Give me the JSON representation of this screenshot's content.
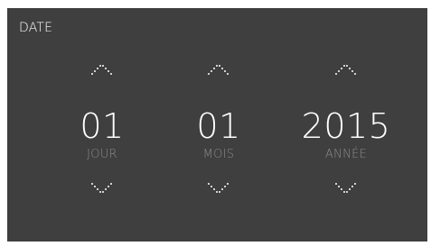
{
  "window": {
    "title": "DATE"
  },
  "columns": [
    {
      "value": "01",
      "label": "JOUR"
    },
    {
      "value": "01",
      "label": "MOIS"
    },
    {
      "value": "2015",
      "label": "ANNÉE"
    }
  ],
  "icons": {
    "up": "chevron-up-icon",
    "down": "chevron-down-icon"
  },
  "colors": {
    "background": "#3f3f3f",
    "text": "#ffffff",
    "label": "#8a8a8a"
  }
}
